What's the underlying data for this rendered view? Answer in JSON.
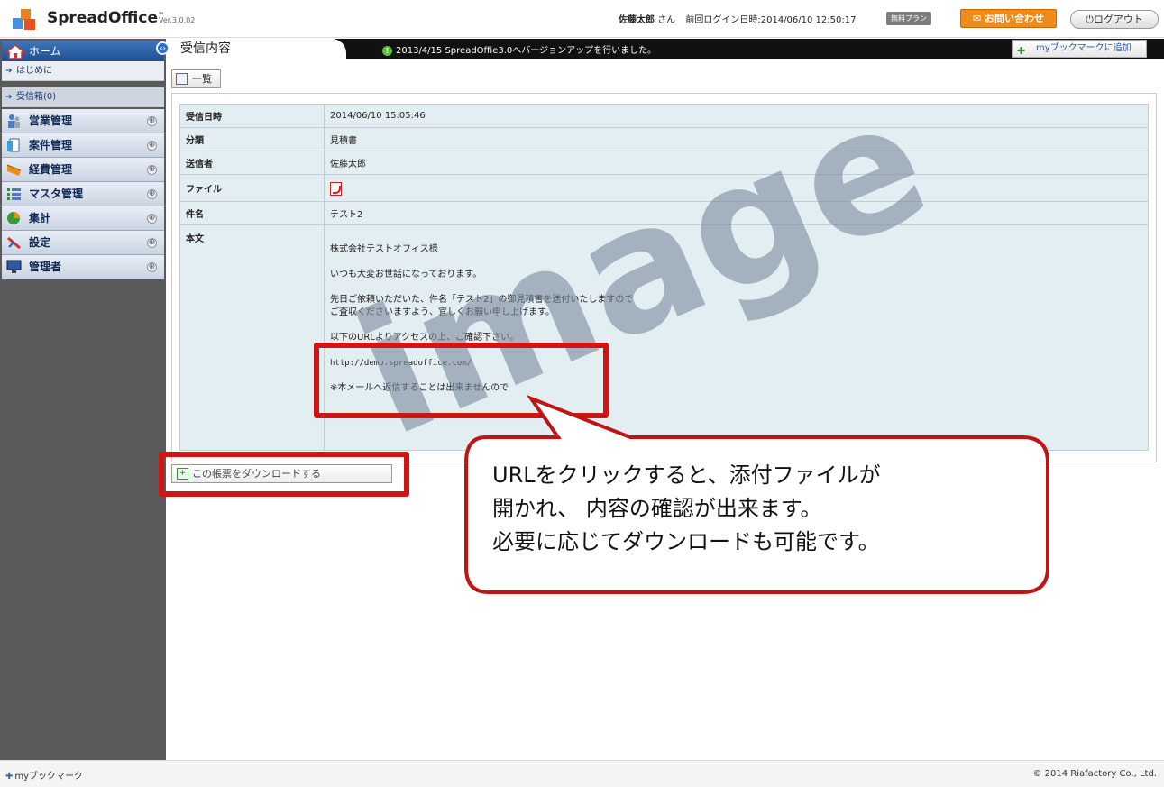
{
  "header": {
    "app_name": "SpreadOffice",
    "trademark": "™",
    "version": "Ver.3.0.02",
    "user_name": "佐藤太郎",
    "honorific": "さん",
    "last_login_label": "前回ログイン日時:2014/06/10 12:50:17",
    "plan_badge": "無料プラン",
    "contact_button": "お問い合わせ",
    "logout_button": "ログアウト"
  },
  "sidebar": {
    "home_label": "ホーム",
    "sub_items": [
      "はじめに",
      "受信箱(0)"
    ],
    "categories": [
      "営業管理",
      "案件管理",
      "経費管理",
      "マスタ管理",
      "集計",
      "設定",
      "管理者"
    ],
    "plus_symbol": "⊕"
  },
  "tab_bar": {
    "tab_label": "受信内容",
    "notice": "2013/4/15 SpreadOffie3.0へバージョンアップを行いました。",
    "bookmark_add": "myブックマークに追加"
  },
  "content": {
    "list_button": "一覧",
    "rows": [
      {
        "label": "受信日時",
        "value": "2014/06/10 15:05:46"
      },
      {
        "label": "分類",
        "value": "見積書"
      },
      {
        "label": "送信者",
        "value": "佐藤太郎"
      },
      {
        "label": "ファイル",
        "value": ""
      },
      {
        "label": "件名",
        "value": "テスト2"
      }
    ],
    "body_label": "本文",
    "body_paragraphs": [
      "株式会社テストオフィス様",
      "いつも大変お世話になっております。",
      "先日ご依頼いただいた、件名「テスト2」の御見積書を送付いたしますので\nご査収くださいますよう、宜しくお願い申し上げます。",
      "以下のURLよりアクセスの上、ご確認下さい。"
    ],
    "body_url": "http://demo.spreadoffice.com/",
    "body_note": "※本メールへ返信することは出来ませんので",
    "download_button": "この帳票をダウンロードする"
  },
  "overlay": {
    "watermark": "image",
    "callout_text": "URLをクリックすると、添付ファイルが\n開かれ、 内容の確認が出来ます。\n必要に応じてダウンロードも可能です。"
  },
  "footer": {
    "bookmark_label": "myブックマーク",
    "copyright": "© 2014 Riafactory Co., Ltd."
  },
  "colors": {
    "accent_orange": "#f08a18",
    "nav_blue": "#1f4f92",
    "highlight_red": "#d01515"
  }
}
